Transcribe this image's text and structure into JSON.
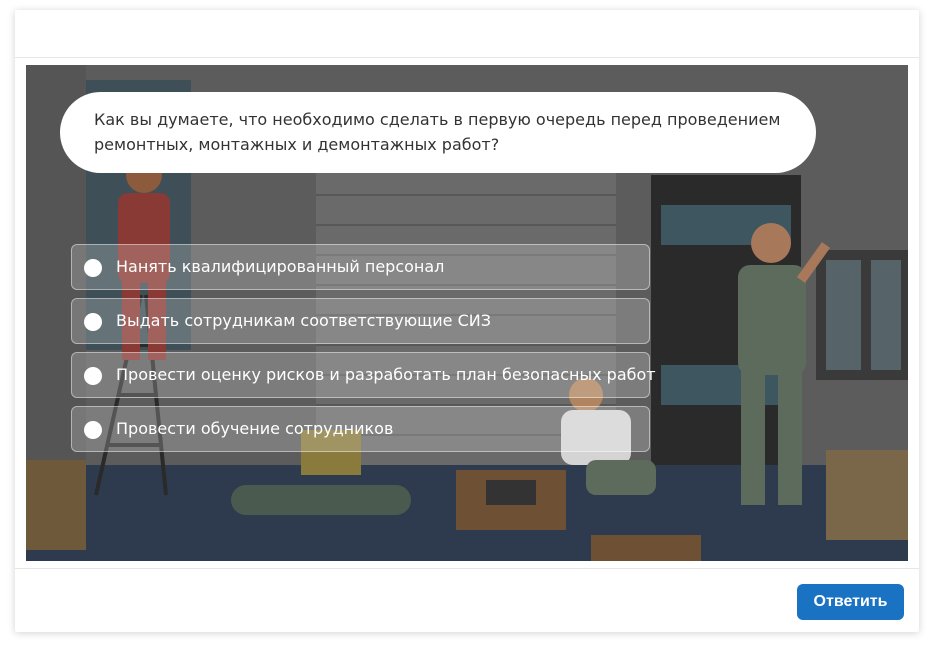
{
  "question": {
    "text": "Как вы думаете, что необходимо сделать в первую очередь перед проведением ремонтных, монтажных и демонтажных работ?"
  },
  "options": [
    {
      "label": "Нанять квалифицированный персонал",
      "selected": false
    },
    {
      "label": "Выдать сотрудникам соответствующие СИЗ",
      "selected": false
    },
    {
      "label": "Провести оценку рисков и разработать план безопасных работ",
      "selected": false
    },
    {
      "label": "Провести обучение сотрудников",
      "selected": false
    }
  ],
  "footer": {
    "submit_label": "Ответить"
  },
  "colors": {
    "accent": "#1a72c2",
    "scene_wall": "#5f5f5f",
    "scene_floor": "#2e3a4d"
  }
}
